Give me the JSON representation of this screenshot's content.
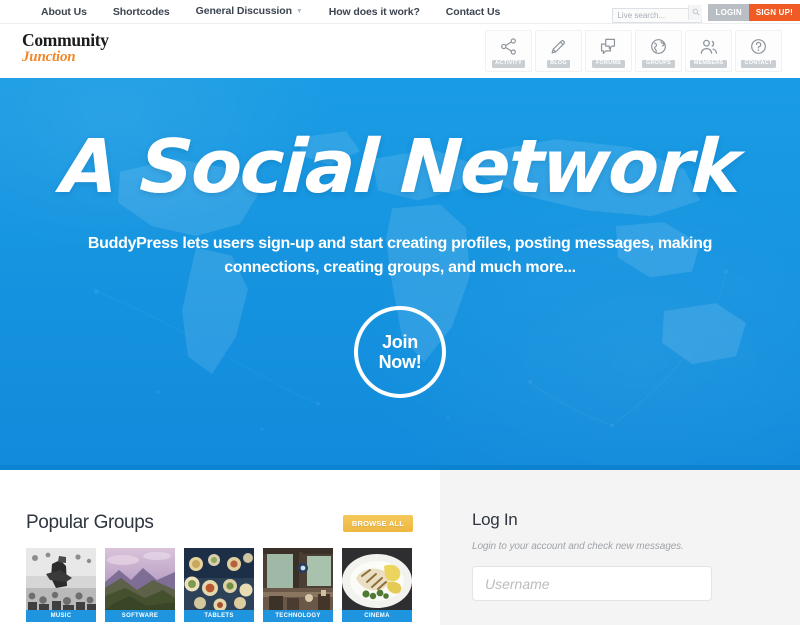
{
  "topbar": {
    "nav": [
      {
        "label": "About Us",
        "has_caret": false
      },
      {
        "label": "Shortcodes",
        "has_caret": false
      },
      {
        "label": "General Discussion",
        "has_caret": true
      },
      {
        "label": "How does it work?",
        "has_caret": false
      },
      {
        "label": "Contact Us",
        "has_caret": false
      }
    ],
    "search_placeholder": "Live search...",
    "search_value": "",
    "search_icon": "magnifier-icon",
    "login_label": "LOGIN",
    "signup_label": "SIGN UP!"
  },
  "header": {
    "logo_line1": "Community",
    "logo_line2": "Junction",
    "icon_nav": [
      {
        "label": "ACTIVITY",
        "icon": "share-nodes-icon"
      },
      {
        "label": "BLOG",
        "icon": "pencil-icon"
      },
      {
        "label": "FORUMS",
        "icon": "chat-bubbles-icon"
      },
      {
        "label": "GROUPS",
        "icon": "globe-icon"
      },
      {
        "label": "MEMBERS",
        "icon": "people-icon"
      },
      {
        "label": "CONTACT",
        "icon": "question-mark-circle-icon"
      }
    ]
  },
  "hero": {
    "title": "A Social Network",
    "subtitle": "BuddyPress lets users sign-up and start creating profiles, posting messages, making connections, creating groups, and much more...",
    "cta_line1": "Join",
    "cta_line2": "Now!",
    "background_color": "#1a9ce4",
    "background_bottom_color": "#0c82d0"
  },
  "groups": {
    "title": "Popular Groups",
    "browse_all_label": "BROWSE ALL",
    "browse_all_color": "#eeb840",
    "label_color": "#1f95e0",
    "cards": [
      {
        "label": "MUSIC",
        "thumb": "concert-crowd-bw-photo"
      },
      {
        "label": "SOFTWARE",
        "thumb": "purple-mountains-photo"
      },
      {
        "label": "TABLETS",
        "thumb": "food-table-spread-photo"
      },
      {
        "label": "TECHNOLOGY",
        "thumb": "cafe-interior-photo"
      },
      {
        "label": "CINEMA",
        "thumb": "grilled-fish-plate-photo"
      }
    ]
  },
  "login": {
    "title": "Log In",
    "subtitle": "Login to your account and check new messages.",
    "username_placeholder": "Username",
    "username_value": ""
  }
}
